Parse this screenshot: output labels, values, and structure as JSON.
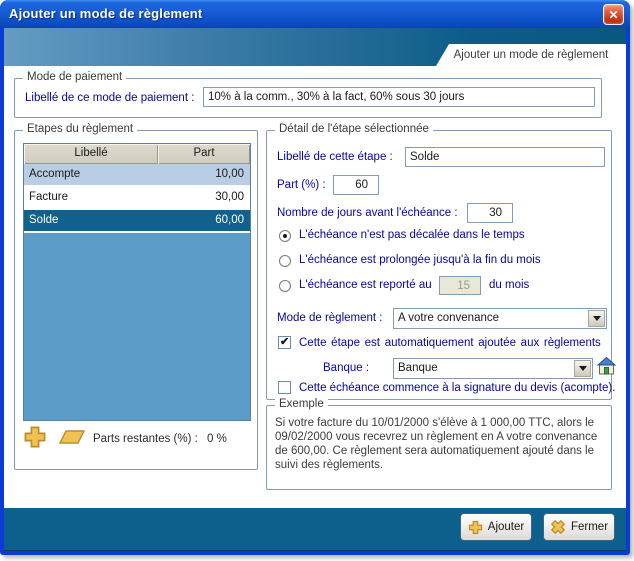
{
  "window": {
    "title": "Ajouter un mode de règlement",
    "tab_title": "Ajouter un mode de règlement"
  },
  "icons": {
    "close_glyph": "✕"
  },
  "colors": {
    "titlebar_blue": "#155cd6",
    "band_teal_dark": "#0d5c88",
    "footer_teal": "#0e608c",
    "selection_blue": "#11618e",
    "table_fill_blue": "#5b9cc9",
    "row_alt_blue": "#b9cde4",
    "gold_icon": "#f2c155",
    "label_navy": "#0505a0"
  },
  "payment_mode": {
    "group_title": "Mode de paiement",
    "label": "Libellé de ce mode de paiement :",
    "value": "10% à la comm., 30% à la fact, 60% sous 30 jours"
  },
  "steps": {
    "group_title": "Etapes du règlement",
    "table": {
      "columns": [
        "Libellé",
        "Part"
      ],
      "rows": [
        {
          "libelle": "Accompte",
          "part": "10,00",
          "selected": false
        },
        {
          "libelle": "Facture",
          "part": "30,00",
          "selected": false
        },
        {
          "libelle": "Solde",
          "part": "60,00",
          "selected": true
        }
      ]
    },
    "remaining_label": "Parts restantes (%) :",
    "remaining_value": "0 %"
  },
  "detail": {
    "group_title": "Détail de l'étape sélectionnée",
    "step_label": "Libellé de cette étape :",
    "step_value": "Solde",
    "part_label": "Part (%) :",
    "part_value": "60",
    "days_label": "Nombre de jours avant l'échéance :",
    "days_value": "30",
    "radios": [
      {
        "label": "L'échéance n'est pas décalée dans le temps",
        "selected": true
      },
      {
        "label": "L'échéance est prolongée jusqu'à la fin du mois",
        "selected": false
      },
      {
        "label_before": "L'échéance est reporté au",
        "day_value": "15",
        "label_after": "du mois",
        "selected": false
      }
    ],
    "mode_label": "Mode de règlement :",
    "mode_value": "A votre convenance",
    "auto_checkbox_label": "Cette étape est automatiquement ajoutée aux règlements",
    "auto_checkbox_checked": true,
    "bank_label": "Banque :",
    "bank_value": "Banque",
    "signature_checkbox_label": "Cette échéance commence à la signature du devis (acompte).",
    "signature_checkbox_checked": false
  },
  "example": {
    "group_title": "Exemple",
    "text": "Si votre facture du 10/01/2000 s'élève à 1 000,00 TTC, alors le 09/02/2000 vous recevrez un règlement en A votre convenance de 600,00.  Ce règlement sera automatiquement ajouté dans le suivi des règlements."
  },
  "footer": {
    "add_label": "Ajouter",
    "close_label": "Fermer"
  }
}
